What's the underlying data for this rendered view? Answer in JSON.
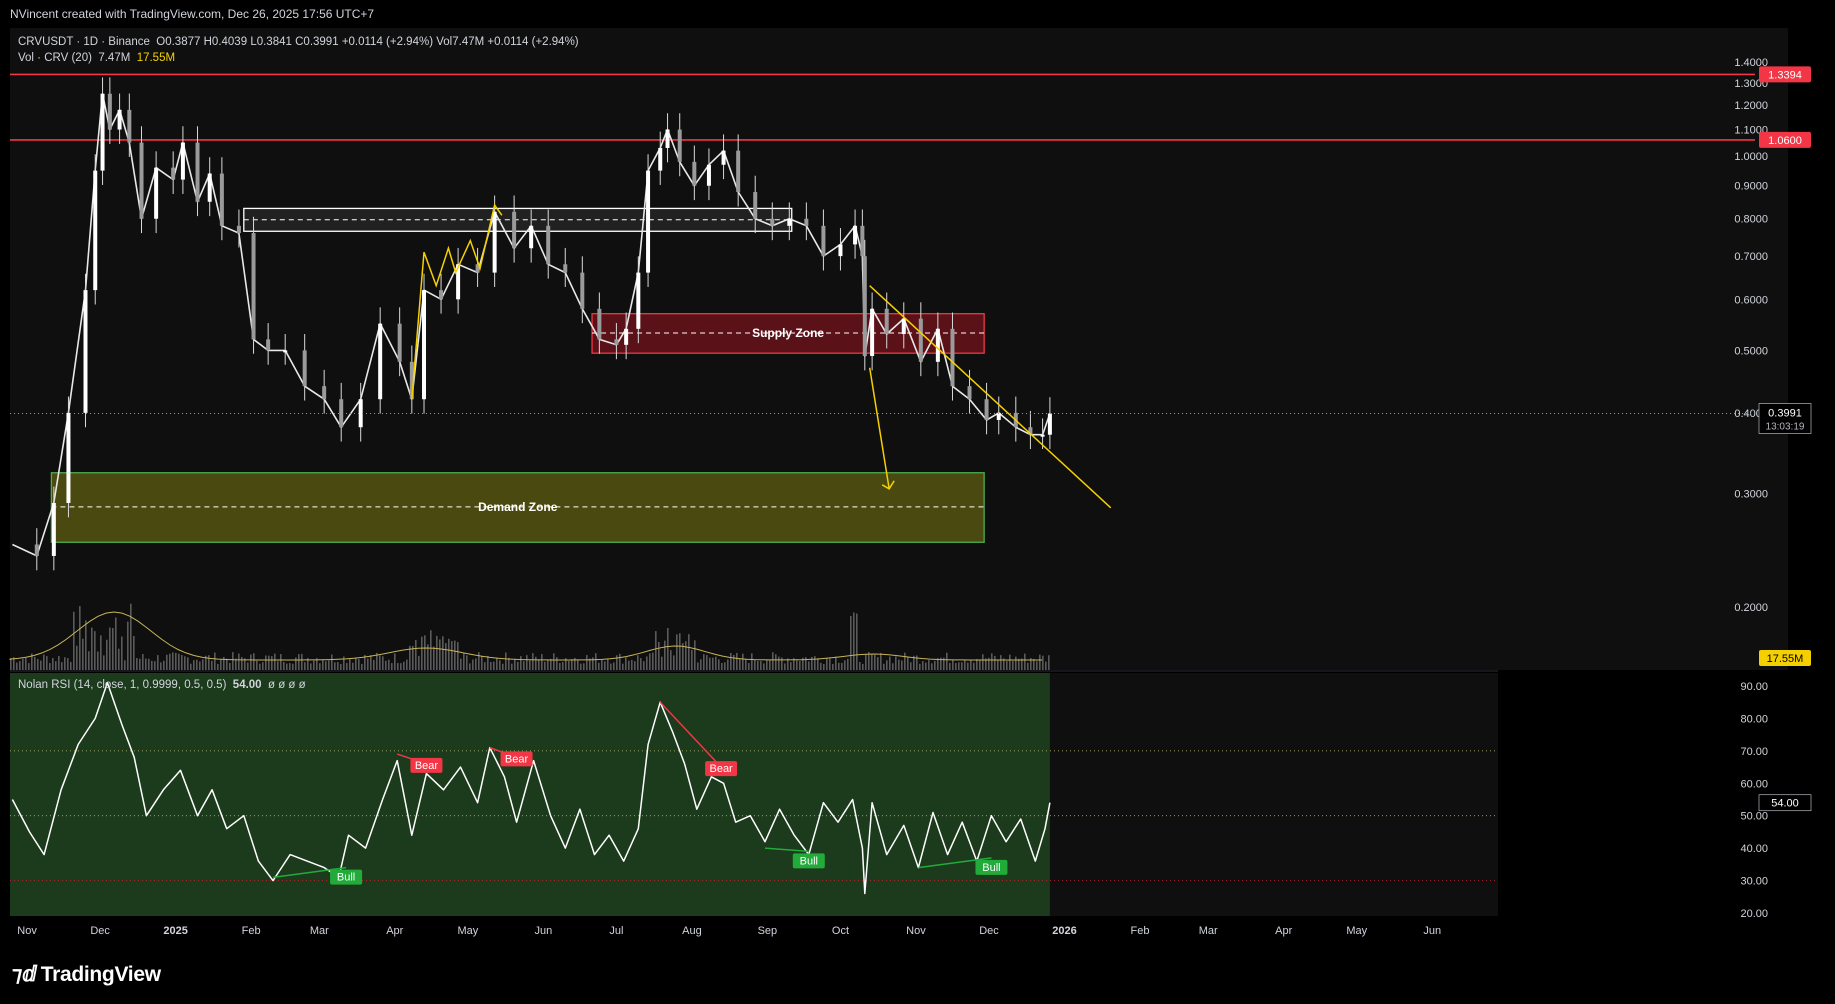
{
  "header": {
    "attribution": "NVincent created with TradingView.com, Dec 26, 2025 17:56 UTC+7"
  },
  "ohlc": {
    "symbol": "CRVUSDT · 1D · Binance",
    "o_label": "O",
    "o": "0.3877",
    "h_label": "H",
    "h": "0.4039",
    "l_label": "L",
    "l": "0.3841",
    "c_label": "C",
    "c": "0.3991",
    "change": "+0.0114 (+2.94%)",
    "vol_label": "Vol",
    "vol": "7.47M",
    "change2": "+0.0114 (+2.94%)"
  },
  "volume_legend": {
    "name": "Vol · CRV (20)",
    "value": "7.47M",
    "ma": "17.55M"
  },
  "rsi_legend": {
    "name": "Nolan RSI (14, close, 1, 0.9999, 0.5, 0.5)",
    "value": "54.00",
    "extras": "ø ø ø ø"
  },
  "footer": {
    "brand": "TradingView"
  },
  "colors": {
    "bg": "#0f0f0f",
    "level_line": "#f23645",
    "supply_fill": "#5a1218",
    "demand_fill": "#4a4a10",
    "trend": "#f5d000",
    "rsi_bg": "#1c3a1c",
    "bull": "#22ab3a",
    "bear": "#f23645"
  },
  "chart_data": [
    {
      "type": "candlestick",
      "title": "CRVUSDT · 1D · Binance",
      "y_scale": "log",
      "ylim": [
        0.16,
        1.45
      ],
      "price_ticks": [
        "1.4000",
        "1.3000",
        "1.2000",
        "1.1000",
        "1.0000",
        "0.9000",
        "0.8000",
        "0.7000",
        "0.6000",
        "0.5000",
        "0.4000",
        "0.3000",
        "0.2000"
      ],
      "x_ticks": [
        "Nov",
        "Dec",
        "2025",
        "Feb",
        "Mar",
        "Apr",
        "May",
        "Jun",
        "Jul",
        "Aug",
        "Sep",
        "Oct",
        "Nov",
        "Dec",
        "2026",
        "Feb",
        "Mar",
        "Apr",
        "May",
        "Jun"
      ],
      "close_path": [
        [
          "2024-10-26",
          0.25
        ],
        [
          "2024-11-05",
          0.24
        ],
        [
          "2024-11-12",
          0.29
        ],
        [
          "2024-11-18",
          0.4
        ],
        [
          "2024-11-25",
          0.62
        ],
        [
          "2024-11-29",
          0.95
        ],
        [
          "2024-12-02",
          1.25
        ],
        [
          "2024-12-05",
          1.1
        ],
        [
          "2024-12-09",
          1.18
        ],
        [
          "2024-12-13",
          1.05
        ],
        [
          "2024-12-18",
          0.8
        ],
        [
          "2024-12-24",
          0.96
        ],
        [
          "2024-12-31",
          0.92
        ],
        [
          "2025-01-04",
          1.05
        ],
        [
          "2025-01-10",
          0.85
        ],
        [
          "2025-01-15",
          0.94
        ],
        [
          "2025-01-20",
          0.78
        ],
        [
          "2025-01-27",
          0.76
        ],
        [
          "2025-02-02",
          0.52
        ],
        [
          "2025-02-08",
          0.5
        ],
        [
          "2025-02-15",
          0.5
        ],
        [
          "2025-02-23",
          0.44
        ],
        [
          "2025-03-03",
          0.42
        ],
        [
          "2025-03-10",
          0.38
        ],
        [
          "2025-03-18",
          0.42
        ],
        [
          "2025-03-26",
          0.55
        ],
        [
          "2025-04-03",
          0.48
        ],
        [
          "2025-04-08",
          0.42
        ],
        [
          "2025-04-13",
          0.62
        ],
        [
          "2025-04-20",
          0.6
        ],
        [
          "2025-04-27",
          0.68
        ],
        [
          "2025-05-05",
          0.66
        ],
        [
          "2025-05-12",
          0.82
        ],
        [
          "2025-05-20",
          0.72
        ],
        [
          "2025-05-27",
          0.78
        ],
        [
          "2025-06-03",
          0.68
        ],
        [
          "2025-06-10",
          0.66
        ],
        [
          "2025-06-17",
          0.58
        ],
        [
          "2025-06-24",
          0.52
        ],
        [
          "2025-07-01",
          0.51
        ],
        [
          "2025-07-05",
          0.54
        ],
        [
          "2025-07-10",
          0.66
        ],
        [
          "2025-07-14",
          0.95
        ],
        [
          "2025-07-19",
          1.03
        ],
        [
          "2025-07-22",
          1.1
        ],
        [
          "2025-07-27",
          0.98
        ],
        [
          "2025-08-02",
          0.9
        ],
        [
          "2025-08-08",
          0.97
        ],
        [
          "2025-08-14",
          1.02
        ],
        [
          "2025-08-20",
          0.88
        ],
        [
          "2025-08-27",
          0.8
        ],
        [
          "2025-09-03",
          0.78
        ],
        [
          "2025-09-10",
          0.8
        ],
        [
          "2025-09-17",
          0.78
        ],
        [
          "2025-09-24",
          0.7
        ],
        [
          "2025-10-01",
          0.73
        ],
        [
          "2025-10-07",
          0.78
        ],
        [
          "2025-10-10",
          0.7
        ],
        [
          "2025-10-11",
          0.49
        ],
        [
          "2025-10-14",
          0.58
        ],
        [
          "2025-10-20",
          0.53
        ],
        [
          "2025-10-27",
          0.56
        ],
        [
          "2025-11-03",
          0.48
        ],
        [
          "2025-11-10",
          0.54
        ],
        [
          "2025-11-16",
          0.44
        ],
        [
          "2025-11-23",
          0.42
        ],
        [
          "2025-11-30",
          0.39
        ],
        [
          "2025-12-05",
          0.4
        ],
        [
          "2025-12-12",
          0.38
        ],
        [
          "2025-12-18",
          0.37
        ],
        [
          "2025-12-23",
          0.37
        ],
        [
          "2025-12-26",
          0.3991
        ]
      ],
      "last_price": "0.3991",
      "countdown": "13:03:19",
      "levels": [
        {
          "price": 1.3394,
          "label": "1.3394"
        },
        {
          "price": 1.06,
          "label": "1.0600"
        }
      ],
      "zones": [
        {
          "name": "resistance-range",
          "x": [
            "2025-01-29",
            "2025-09-11"
          ],
          "y": [
            0.765,
            0.83
          ],
          "mid": 0.797,
          "style": "white"
        },
        {
          "name": "Supply Zone",
          "x": [
            "2025-06-21",
            "2025-11-29"
          ],
          "y": [
            0.495,
            0.57
          ],
          "mid": 0.532,
          "style": "red"
        },
        {
          "name": "Demand Zone",
          "x": [
            "2024-11-11",
            "2025-11-29"
          ],
          "y": [
            0.252,
            0.323
          ],
          "mid": 0.286,
          "style": "green"
        }
      ],
      "annotations": [
        {
          "type": "trendline",
          "x": [
            "2025-10-13",
            "2026-01-20"
          ],
          "y": [
            0.63,
            0.285
          ]
        },
        {
          "type": "arrow",
          "x": [
            "2025-10-13",
            "2025-10-21"
          ],
          "y": [
            0.47,
            0.305
          ]
        },
        {
          "type": "zigzag",
          "x": [
            "2025-04-08",
            "2025-04-13",
            "2025-04-18",
            "2025-04-23",
            "2025-04-26",
            "2025-05-02",
            "2025-05-06",
            "2025-05-12",
            "2025-05-15"
          ],
          "y": [
            0.42,
            0.71,
            0.63,
            0.72,
            0.66,
            0.74,
            0.67,
            0.84,
            0.81
          ]
        }
      ]
    },
    {
      "type": "bar",
      "title": "Vol · CRV (20)",
      "value": "7.47M",
      "ma_value": "17.55M"
    },
    {
      "type": "line",
      "title": "Nolan RSI (14, close, 1, 0.9999, 0.5, 0.5)",
      "value": "54.00",
      "ylim": [
        20,
        95
      ],
      "y_ticks": [
        "90.00",
        "80.00",
        "70.00",
        "60.00",
        "50.00",
        "40.00",
        "30.00",
        "20.00"
      ],
      "levels": [
        70,
        50,
        30
      ],
      "series": [
        [
          "2024-10-26",
          55
        ],
        [
          "2024-11-02",
          45
        ],
        [
          "2024-11-08",
          38
        ],
        [
          "2024-11-15",
          58
        ],
        [
          "2024-11-22",
          72
        ],
        [
          "2024-11-29",
          80
        ],
        [
          "2024-12-04",
          91
        ],
        [
          "2024-12-10",
          78
        ],
        [
          "2024-12-15",
          68
        ],
        [
          "2024-12-20",
          50
        ],
        [
          "2024-12-27",
          58
        ],
        [
          "2025-01-03",
          64
        ],
        [
          "2025-01-10",
          50
        ],
        [
          "2025-01-16",
          58
        ],
        [
          "2025-01-22",
          46
        ],
        [
          "2025-01-29",
          50
        ],
        [
          "2025-02-04",
          36
        ],
        [
          "2025-02-10",
          30
        ],
        [
          "2025-02-17",
          38
        ],
        [
          "2025-02-24",
          36
        ],
        [
          "2025-03-03",
          34
        ],
        [
          "2025-03-09",
          31
        ],
        [
          "2025-03-13",
          44
        ],
        [
          "2025-03-20",
          40
        ],
        [
          "2025-03-27",
          55
        ],
        [
          "2025-04-02",
          67
        ],
        [
          "2025-04-08",
          44
        ],
        [
          "2025-04-14",
          63
        ],
        [
          "2025-04-21",
          58
        ],
        [
          "2025-04-28",
          65
        ],
        [
          "2025-05-05",
          54
        ],
        [
          "2025-05-10",
          71
        ],
        [
          "2025-05-16",
          62
        ],
        [
          "2025-05-21",
          48
        ],
        [
          "2025-05-28",
          67
        ],
        [
          "2025-06-04",
          50
        ],
        [
          "2025-06-10",
          40
        ],
        [
          "2025-06-16",
          52
        ],
        [
          "2025-06-22",
          38
        ],
        [
          "2025-06-28",
          44
        ],
        [
          "2025-07-04",
          36
        ],
        [
          "2025-07-10",
          46
        ],
        [
          "2025-07-14",
          72
        ],
        [
          "2025-07-19",
          85
        ],
        [
          "2025-07-24",
          76
        ],
        [
          "2025-07-29",
          66
        ],
        [
          "2025-08-03",
          52
        ],
        [
          "2025-08-09",
          62
        ],
        [
          "2025-08-14",
          60
        ],
        [
          "2025-08-19",
          48
        ],
        [
          "2025-08-25",
          50
        ],
        [
          "2025-08-31",
          42
        ],
        [
          "2025-09-06",
          52
        ],
        [
          "2025-09-12",
          44
        ],
        [
          "2025-09-18",
          38
        ],
        [
          "2025-09-24",
          54
        ],
        [
          "2025-09-30",
          48
        ],
        [
          "2025-10-06",
          55
        ],
        [
          "2025-10-10",
          40
        ],
        [
          "2025-10-11",
          26
        ],
        [
          "2025-10-14",
          54
        ],
        [
          "2025-10-20",
          38
        ],
        [
          "2025-10-27",
          47
        ],
        [
          "2025-11-02",
          34
        ],
        [
          "2025-11-08",
          51
        ],
        [
          "2025-11-14",
          38
        ],
        [
          "2025-11-20",
          48
        ],
        [
          "2025-11-26",
          36
        ],
        [
          "2025-12-02",
          50
        ],
        [
          "2025-12-08",
          42
        ],
        [
          "2025-12-14",
          49
        ],
        [
          "2025-12-20",
          36
        ],
        [
          "2025-12-24",
          46
        ],
        [
          "2025-12-26",
          54
        ]
      ],
      "divergences": [
        {
          "label": "Bear",
          "x": [
            "2025-04-02",
            "2025-04-14"
          ],
          "y": [
            69,
            66
          ]
        },
        {
          "label": "Bear",
          "x": [
            "2025-05-10",
            "2025-05-21"
          ],
          "y": [
            71,
            68
          ]
        },
        {
          "label": "Bear",
          "x": [
            "2025-07-19",
            "2025-08-13"
          ],
          "y": [
            85,
            65
          ]
        },
        {
          "label": "Bull",
          "x": [
            "2025-02-10",
            "2025-03-12"
          ],
          "y": [
            31,
            34
          ]
        },
        {
          "label": "Bull",
          "x": [
            "2025-08-31",
            "2025-09-18"
          ],
          "y": [
            40,
            39
          ]
        },
        {
          "label": "Bull",
          "x": [
            "2025-11-02",
            "2025-12-02"
          ],
          "y": [
            34,
            37
          ]
        }
      ]
    }
  ]
}
